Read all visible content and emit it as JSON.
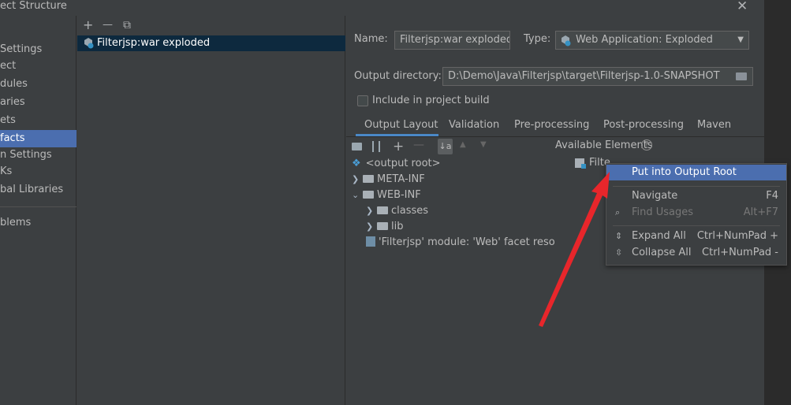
{
  "window": {
    "title": "ect Structure",
    "close_glyph": "✕"
  },
  "nav": {
    "items": [
      {
        "label": "Settings",
        "selected": false
      },
      {
        "label": "ect",
        "selected": false
      },
      {
        "label": "dules",
        "selected": false
      },
      {
        "label": "aries",
        "selected": false
      },
      {
        "label": "ets",
        "selected": false
      },
      {
        "label": "facts",
        "selected": true
      },
      {
        "label": "n Settings",
        "selected": false
      },
      {
        "label": "Ks",
        "selected": false
      },
      {
        "label": "bal Libraries",
        "selected": false
      },
      {
        "label": "blems",
        "selected": false
      }
    ]
  },
  "artifacts": {
    "toolbar": {
      "add": "+",
      "remove": "—",
      "copy": "⧉"
    },
    "items": [
      {
        "label": "Filterjsp:war exploded"
      }
    ]
  },
  "settings": {
    "name_label": "Name:",
    "name_value": "Filterjsp:war exploded",
    "type_label": "Type:",
    "type_value": "Web Application: Exploded",
    "output_dir_label": "Output directory:",
    "output_dir_value": "D:\\Demo\\Java\\Filterjsp\\target\\Filterjsp-1.0-SNAPSHOT",
    "include_label": "Include in project build",
    "include_checked": false,
    "tabs": [
      {
        "label": "Output Layout",
        "active": true
      },
      {
        "label": "Validation",
        "active": false
      },
      {
        "label": "Pre-processing",
        "active": false
      },
      {
        "label": "Post-processing",
        "active": false
      },
      {
        "label": "Maven",
        "active": false
      }
    ],
    "available_label": "Available Elements",
    "available_item": "Filte",
    "tree": {
      "root": "<output root>",
      "meta_inf": "META-INF",
      "web_inf": "WEB-INF",
      "classes": "classes",
      "lib": "lib",
      "facet": "'Filterjsp' module: 'Web' facet resource"
    }
  },
  "context_menu": {
    "items": [
      {
        "label": "Put into Output Root",
        "shortcut": "",
        "highlighted": true,
        "disabled": false
      },
      {
        "label": "Navigate",
        "shortcut": "F4",
        "highlighted": false,
        "disabled": false
      },
      {
        "label": "Find Usages",
        "shortcut": "Alt+F7",
        "highlighted": false,
        "disabled": true
      },
      {
        "label": "Expand All",
        "shortcut": "Ctrl+NumPad +",
        "highlighted": false,
        "disabled": false
      },
      {
        "label": "Collapse All",
        "shortcut": "Ctrl+NumPad -",
        "highlighted": false,
        "disabled": false
      }
    ]
  },
  "annotation": {
    "arrow_color": "#e8262b"
  },
  "colors": {
    "selection": "#4b6eaf",
    "background": "#3c3f41",
    "accent_tab": "#4a88c7"
  }
}
